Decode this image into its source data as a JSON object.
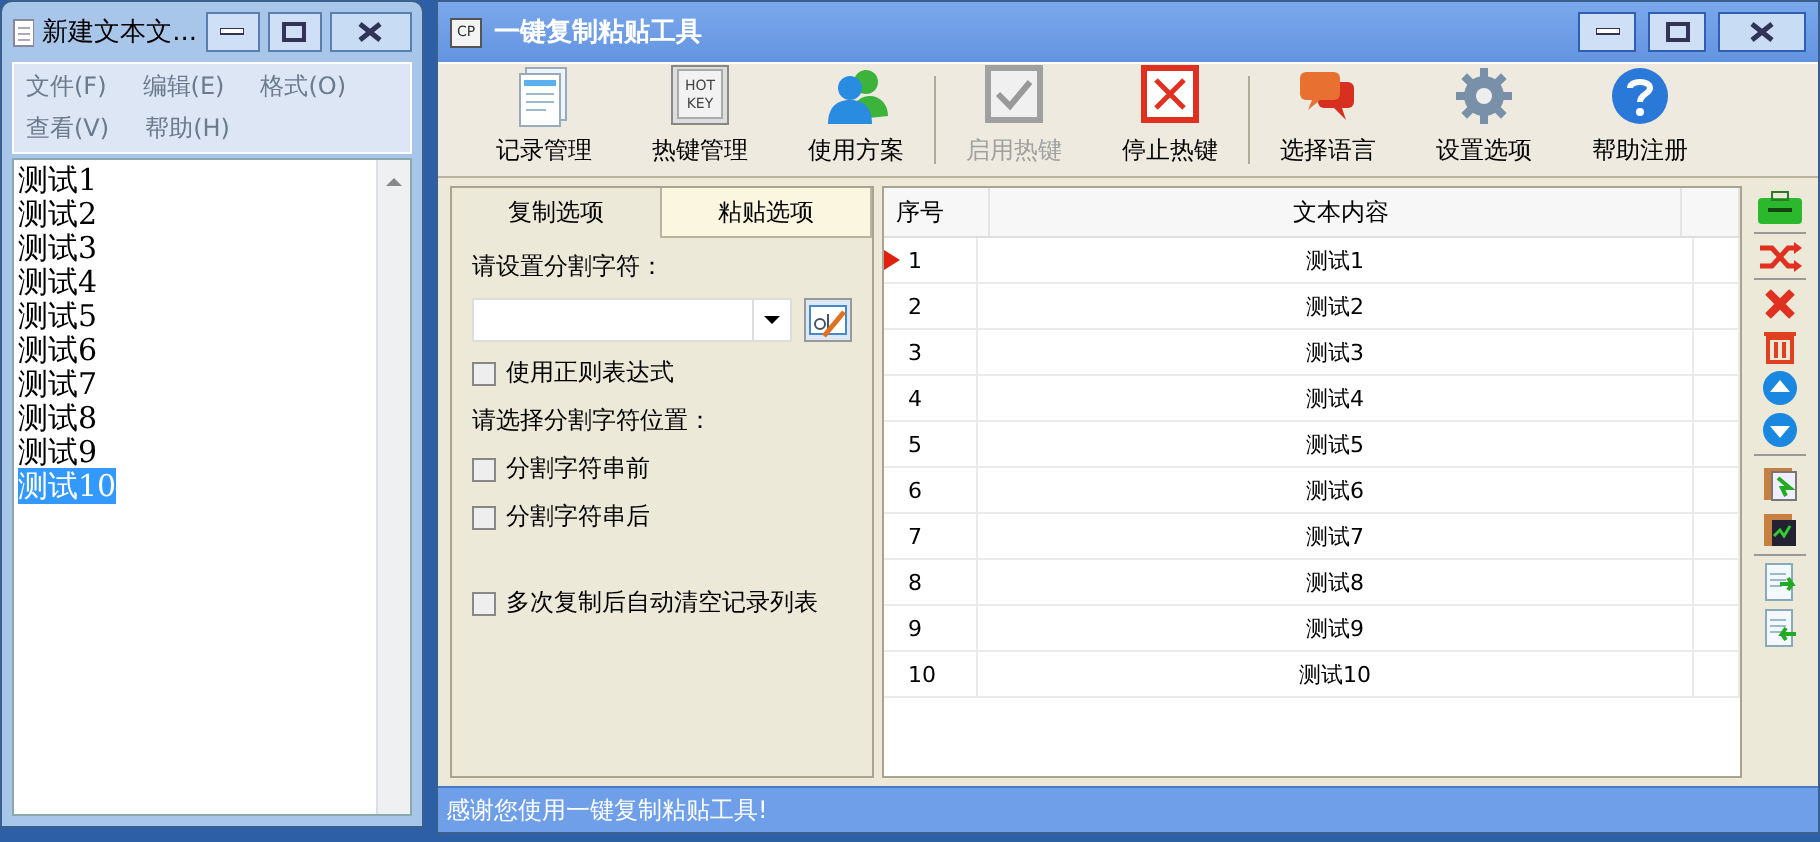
{
  "notepad": {
    "title": "新建文本文...",
    "menu": [
      "文件(F)",
      "编辑(E)",
      "格式(O)",
      "查看(V)",
      "帮助(H)"
    ],
    "lines": [
      {
        "text": "测试1",
        "selected": false
      },
      {
        "text": "测试2",
        "selected": false
      },
      {
        "text": "测试3",
        "selected": false
      },
      {
        "text": "测试4",
        "selected": false
      },
      {
        "text": "测试5",
        "selected": false
      },
      {
        "text": "测试6",
        "selected": false
      },
      {
        "text": "测试7",
        "selected": false
      },
      {
        "text": "测试8",
        "selected": false
      },
      {
        "text": "测试9",
        "selected": false
      },
      {
        "text": "测试10",
        "selected": true
      }
    ]
  },
  "app": {
    "title": "一键复制粘贴工具",
    "logo": "CP",
    "toolbar": [
      {
        "kind": "button",
        "label": "记录管理",
        "disabled": false
      },
      {
        "kind": "button",
        "icon_text": [
          "HOT",
          "KEY"
        ],
        "label": "热键管理",
        "disabled": false
      },
      {
        "kind": "button",
        "label": "使用方案",
        "disabled": false
      },
      {
        "kind": "separator"
      },
      {
        "kind": "button",
        "label": "启用热键",
        "disabled": true
      },
      {
        "kind": "button",
        "label": "停止热键",
        "disabled": false
      },
      {
        "kind": "separator"
      },
      {
        "kind": "button",
        "label": "选择语言",
        "disabled": false
      },
      {
        "kind": "button",
        "label": "设置选项",
        "disabled": false
      },
      {
        "kind": "button",
        "label": "帮助注册",
        "disabled": false
      }
    ],
    "tabs": [
      {
        "label": "复制选项",
        "selected": true
      },
      {
        "label": "粘贴选项",
        "selected": false
      }
    ],
    "options": [
      {
        "kind": "label",
        "text": "请设置分割字符："
      },
      {
        "kind": "combo"
      },
      {
        "kind": "checkbox",
        "text": "使用正则表达式",
        "checked": false
      },
      {
        "kind": "label",
        "text": "请选择分割字符位置："
      },
      {
        "kind": "checkbox",
        "text": "分割字符串前",
        "checked": false
      },
      {
        "kind": "checkbox",
        "text": "分割字符串后",
        "checked": false
      },
      {
        "kind": "spacer"
      },
      {
        "kind": "checkbox",
        "text": "多次复制后自动清空记录列表",
        "checked": false
      }
    ],
    "table": {
      "columns": [
        "序号",
        "文本内容"
      ],
      "rows": [
        {
          "index": "1",
          "text": "测试1",
          "current": true
        },
        {
          "index": "2",
          "text": "测试2",
          "current": false
        },
        {
          "index": "3",
          "text": "测试3",
          "current": false
        },
        {
          "index": "4",
          "text": "测试4",
          "current": false
        },
        {
          "index": "5",
          "text": "测试5",
          "current": false
        },
        {
          "index": "6",
          "text": "测试6",
          "current": false
        },
        {
          "index": "7",
          "text": "测试7",
          "current": false
        },
        {
          "index": "8",
          "text": "测试8",
          "current": false
        },
        {
          "index": "9",
          "text": "测试9",
          "current": false
        },
        {
          "index": "10",
          "text": "测试10",
          "current": false
        }
      ]
    },
    "status": "感谢您使用一键复制粘贴工具!"
  }
}
